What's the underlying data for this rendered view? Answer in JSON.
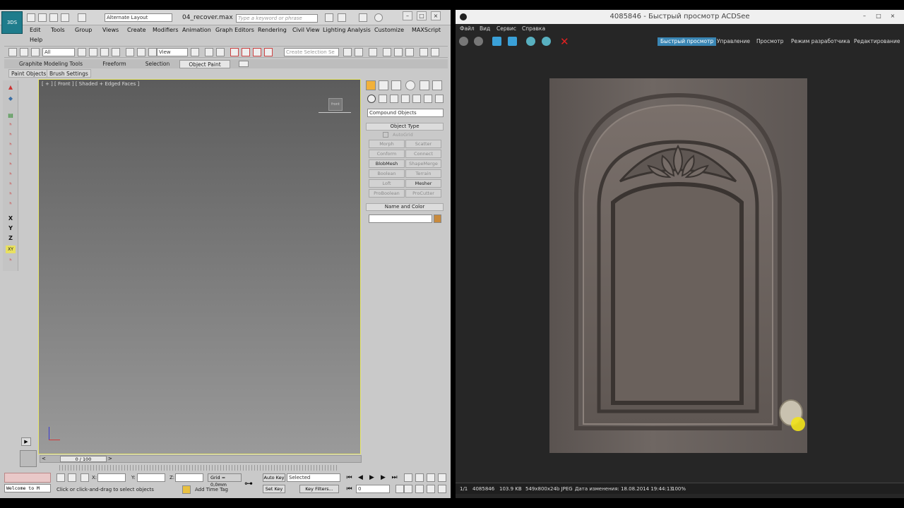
{
  "max": {
    "layout": "Alternate Layout",
    "filename": "04_recover.max",
    "search_placeholder": "Type a keyword or phrase",
    "logo": "3DS",
    "menu": [
      "Edit",
      "Tools",
      "Group",
      "Views",
      "Create",
      "Modifiers",
      "Animation",
      "Graph Editors",
      "Rendering",
      "Civil View",
      "Lighting Analysis",
      "Customize",
      "MAXScript",
      "Help"
    ],
    "filter_all": "All",
    "ref_view": "View",
    "selection_set": "Create Selection Se",
    "ribbon_tabs": [
      "Graphite Modeling Tools",
      "Freeform",
      "Selection",
      "Object Paint"
    ],
    "ribbon_subtabs": [
      "Paint Objects",
      "Brush Settings"
    ],
    "axes": [
      "X",
      "Y",
      "Z",
      "XY"
    ],
    "viewport_label": "[ + ] [ Front ] [ Shaded + Edged Faces ]",
    "viewcube": "front",
    "cmd_dropdown": "Compound Objects",
    "object_type_title": "Object Type",
    "autogrid": "AutoGrid",
    "buttons": [
      {
        "label": "Morph",
        "on": false
      },
      {
        "label": "Scatter",
        "on": false
      },
      {
        "label": "Conform",
        "on": false
      },
      {
        "label": "Connect",
        "on": false
      },
      {
        "label": "BlobMesh",
        "on": true
      },
      {
        "label": "ShapeMerge",
        "on": false
      },
      {
        "label": "Boolean",
        "on": false
      },
      {
        "label": "Terrain",
        "on": false
      },
      {
        "label": "Loft",
        "on": false
      },
      {
        "label": "Mesher",
        "on": true
      },
      {
        "label": "ProBoolean",
        "on": false
      },
      {
        "label": "ProCutter",
        "on": false
      }
    ],
    "name_color_title": "Name and Color",
    "swatch_color": "#c88a3c",
    "time_slider": "0 / 100",
    "welcome": "Welcome to M",
    "prompt": "Click or click-and-drag to select objects",
    "x_label": "X:",
    "y_label": "Y:",
    "z_label": "Z:",
    "grid": "Grid = 0,0mm",
    "auto_key": "Auto Key",
    "selected": "Selected",
    "set_key": "Set Key",
    "key_filters": "Key Filters...",
    "frame": "0",
    "add_time_tag": "Add Time Tag"
  },
  "acd": {
    "title": "4085846 - Быстрый просмотр ACDSee",
    "menu": [
      "Файл",
      "Вид",
      "Сервис",
      "Справка"
    ],
    "modes": [
      "Быстрый просмотр",
      "Управление",
      "Просмотр",
      "Режим разработчика",
      "Редактирование"
    ],
    "status": [
      "1/1",
      "4085846",
      "103.9 KB",
      "549x800x24b JPEG",
      "Дата изменения: 18.08.2014 19:44:13",
      "100%"
    ]
  }
}
